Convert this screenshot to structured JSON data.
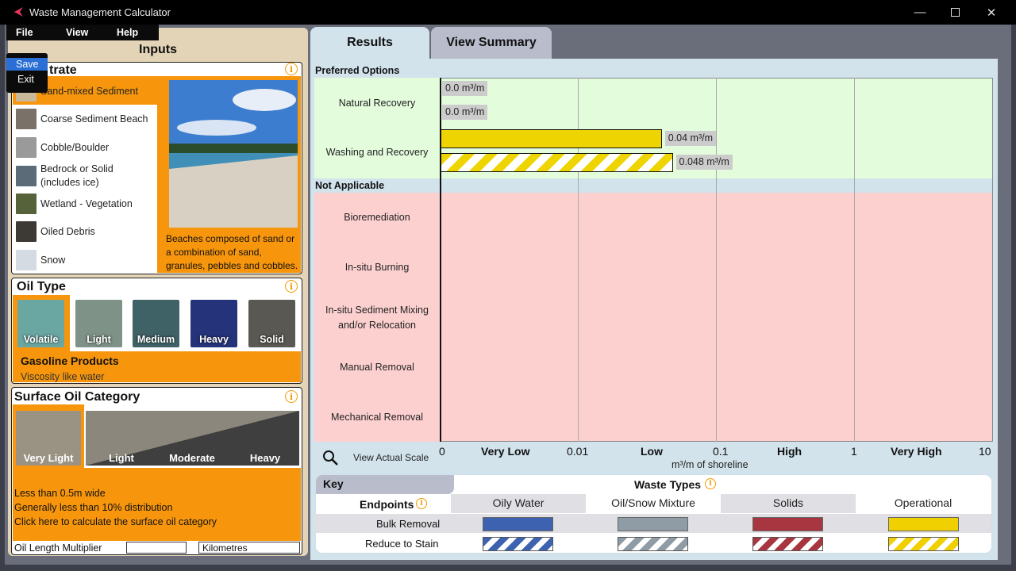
{
  "window": {
    "title": "Waste Management Calculator"
  },
  "menu": {
    "file": "File",
    "view": "View",
    "help": "Help",
    "file_items": [
      "Save",
      "Exit"
    ]
  },
  "inputs": {
    "title": "Inputs",
    "substrate": {
      "heading": "trate",
      "items": [
        "Sand-mixed Sediment",
        "Coarse Sediment Beach",
        "Cobble/Boulder",
        "Bedrock or Solid (includes ice)",
        "Wetland - Vegetation",
        "Oiled Debris",
        "Snow"
      ],
      "description": "Beaches composed of sand or a combination of sand, granules, pebbles and cobbles."
    },
    "oil_type": {
      "heading": "Oil Type",
      "items": [
        "Volatile",
        "Light",
        "Medium",
        "Heavy",
        "Solid"
      ],
      "product": "Gasoline Products",
      "viscosity": "Viscosity like water"
    },
    "surface_oil": {
      "heading": "Surface Oil Category",
      "items": [
        "Very Light",
        "Light",
        "Moderate",
        "Heavy"
      ],
      "lines": [
        "Less than 0.5m wide",
        "Generally less than 10% distribution",
        "Click here to calculate the surface oil category"
      ],
      "multiplier_label": "Oil Length Multiplier",
      "multiplier_value": "",
      "unit": "Kilometres"
    }
  },
  "tabs": {
    "results": "Results",
    "summary": "View Summary"
  },
  "results": {
    "preferred_label": "Preferred Options",
    "not_applicable_label": "Not Applicable",
    "preferred": [
      {
        "name": "Natural Recovery",
        "values": [
          "0.0 m³/m",
          "0.0 m³/m"
        ]
      },
      {
        "name": "Washing and Recovery",
        "values": [
          "0.04 m³/m",
          "0.048 m³/m"
        ]
      }
    ],
    "not_applicable": [
      "Bioremediation",
      "In-situ Burning",
      "In-situ Sediment Mixing and/or Relocation",
      "Manual Removal",
      "Mechanical Removal"
    ],
    "zoom_label": "View Actual Scale",
    "axis": {
      "ticks": [
        "0",
        "0.01",
        "0.1",
        "1",
        "10"
      ],
      "categories": [
        "Very Low",
        "Low",
        "High",
        "Very High"
      ],
      "xlabel": "m³/m of shoreline"
    }
  },
  "chart_data": {
    "type": "bar",
    "categories": [
      "Natural Recovery",
      "Washing and Recovery"
    ],
    "series": [
      {
        "name": "Bulk Removal",
        "values": [
          0.0,
          0.04
        ]
      },
      {
        "name": "Reduce to Stain",
        "values": [
          0.0,
          0.048
        ]
      }
    ],
    "xlabel": "m³/m of shoreline",
    "xscale": "log",
    "xlim": [
      0,
      10
    ]
  },
  "key": {
    "title": "Key",
    "waste_types_label": "Waste Types",
    "endpoints_label": "Endpoints",
    "types": [
      "Oily Water",
      "Oil/Snow Mixture",
      "Solids",
      "Operational"
    ],
    "endpoints": [
      "Bulk Removal",
      "Reduce to Stain"
    ],
    "colors": [
      "#3d62b0",
      "#8f9ba5",
      "#a83640",
      "#f0d000"
    ]
  },
  "colors": {
    "accent": "#f7960c",
    "preferred_bg": "#e3fcdc",
    "not_applicable_bg": "#fdd0d0",
    "bar_yellow": "#eed400"
  }
}
